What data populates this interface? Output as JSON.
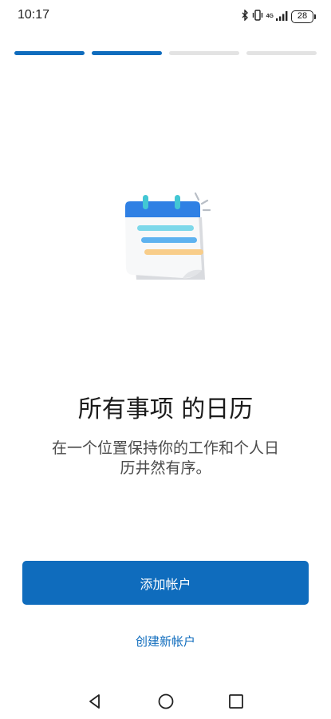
{
  "status_bar": {
    "time": "10:17",
    "network": "4G",
    "battery": "28",
    "icons": [
      "bluetooth-icon",
      "vibrate-icon",
      "signal-icon",
      "battery-icon"
    ]
  },
  "onboarding": {
    "step_current": 2,
    "step_total": 4,
    "title": "所有事项 的日历",
    "subtitle": "在一个位置保持你的工作和个人日历井然有序。"
  },
  "actions": {
    "primary_label": "添加帐户",
    "secondary_label": "创建新帐户"
  },
  "navigation": {
    "icons": [
      "back-icon",
      "home-icon",
      "recents-icon"
    ]
  },
  "colors": {
    "accent": "#0f6cbd",
    "progress_inactive": "#e3e3e3",
    "calendar_header": "#2f80e4",
    "line_cyan": "#7dd8ea",
    "line_blue": "#5db2f0",
    "line_orange": "#f8cd8a"
  }
}
